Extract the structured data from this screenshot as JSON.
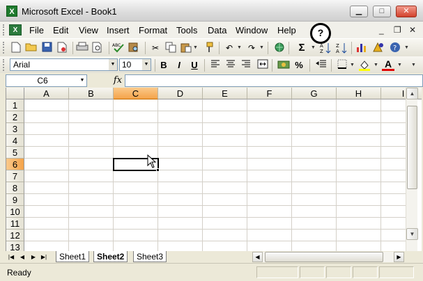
{
  "window": {
    "title": "Microsoft Excel - Book1",
    "app_icon": "excel-icon"
  },
  "menu": {
    "items": [
      "File",
      "Edit",
      "View",
      "Insert",
      "Format",
      "Tools",
      "Data",
      "Window",
      "Help"
    ],
    "help_icon_glyph": "?"
  },
  "standard_toolbar": {
    "icons": [
      "new-icon",
      "open-icon",
      "save-icon",
      "permission-icon",
      "print-icon",
      "print-preview-icon",
      "spelling-icon",
      "research-icon",
      "cut-icon",
      "copy-icon",
      "paste-icon",
      "format-painter-icon",
      "undo-icon",
      "redo-icon",
      "hyperlink-icon",
      "autosum-icon",
      "sort-ascending-icon",
      "sort-descending-icon",
      "chart-wizard-icon",
      "drawing-icon",
      "help-icon"
    ],
    "autosum_glyph": "Σ"
  },
  "formatting_toolbar": {
    "font": "Arial",
    "size": "10",
    "bold": "B",
    "italic": "I",
    "underline": "U",
    "percent": "%",
    "font_color_glyph": "A"
  },
  "formula_bar": {
    "name_box": "C6",
    "fx": "fx",
    "formula": ""
  },
  "grid": {
    "columns": [
      "A",
      "B",
      "C",
      "D",
      "E",
      "F",
      "G",
      "H",
      "I"
    ],
    "rows": [
      "1",
      "2",
      "3",
      "4",
      "5",
      "6",
      "7",
      "8",
      "9",
      "10",
      "11",
      "12",
      "13"
    ],
    "active_column": "C",
    "active_row": "6"
  },
  "sheets": {
    "tabs": [
      "Sheet1",
      "Sheet2",
      "Sheet3"
    ],
    "active": "Sheet2"
  },
  "status": {
    "text": "Ready"
  }
}
